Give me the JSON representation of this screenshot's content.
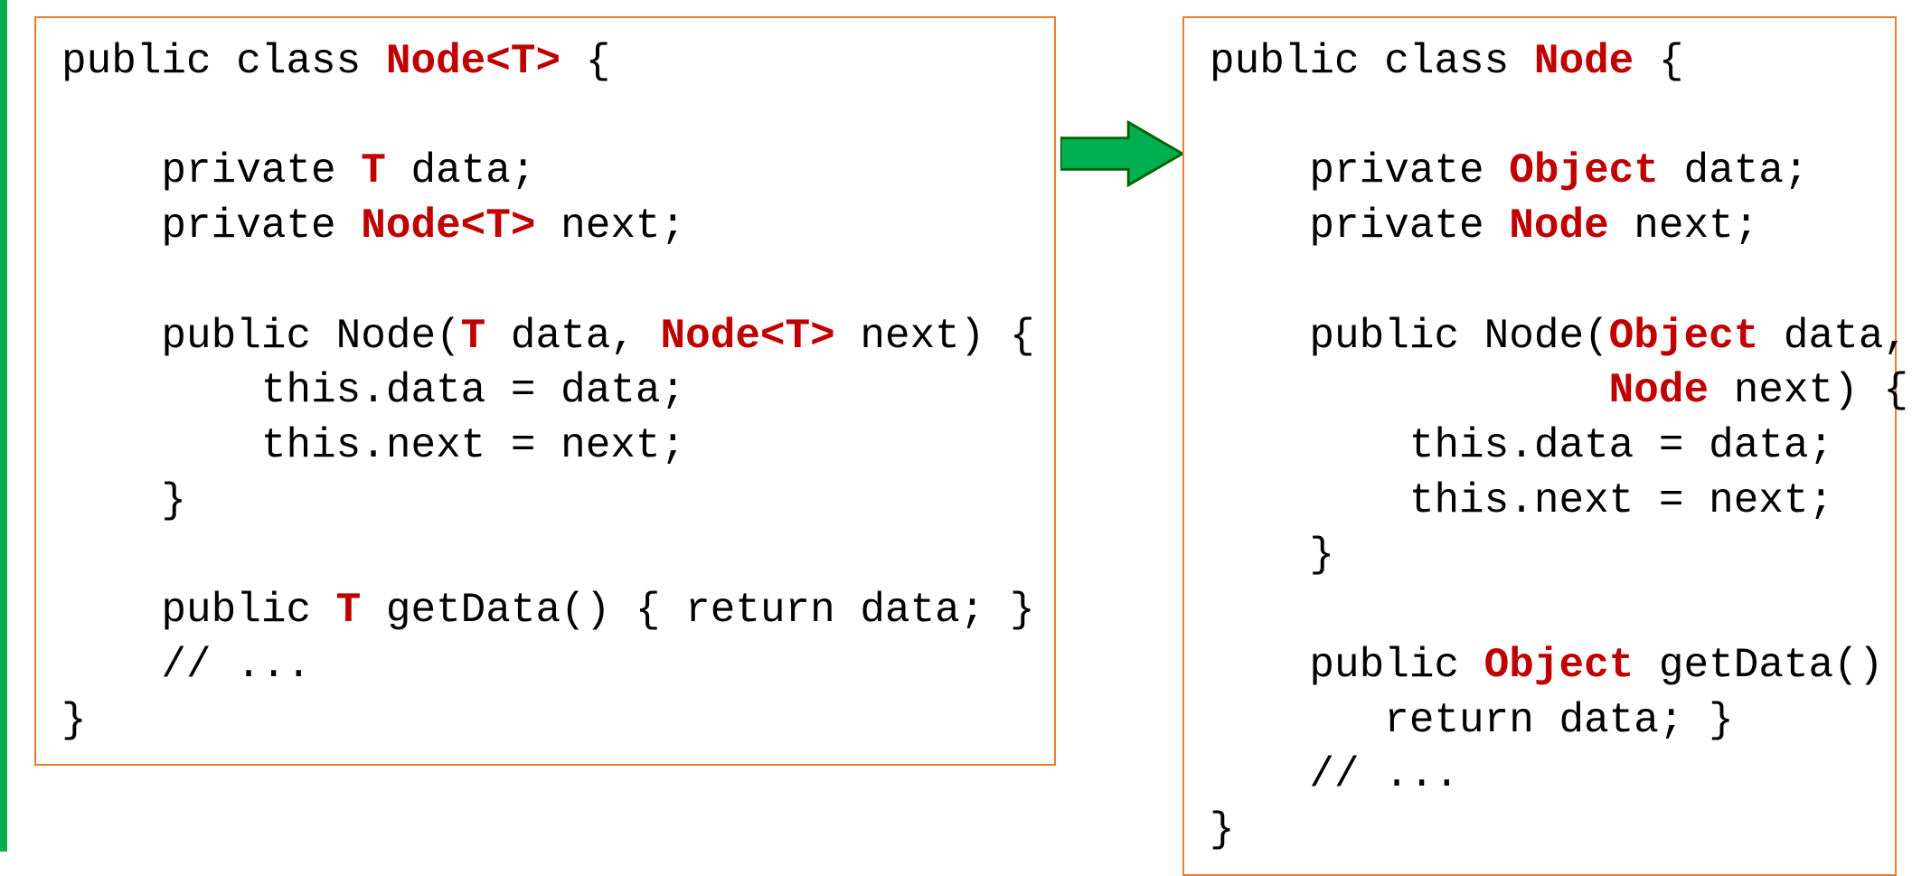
{
  "left": {
    "t0a": "public class ",
    "t0b": "Node<T>",
    "t0c": " {",
    "blank": "",
    "t1a": "    private ",
    "t1b": "T",
    "t1c": " data;",
    "t2a": "    private ",
    "t2b": "Node<T>",
    "t2c": " next;",
    "t3a": "    public Node(",
    "t3b": "T",
    "t3c": " data, ",
    "t3d": "Node<T>",
    "t3e": " next) {",
    "t4": "        this.data = data;",
    "t5": "        this.next = next;",
    "t6": "    }",
    "t7a": "    public ",
    "t7b": "T",
    "t7c": " getData() { return data; }",
    "t8": "    // ...",
    "t9": "}"
  },
  "right": {
    "t0a": "public class ",
    "t0b": "Node",
    "t0c": " {",
    "blank": "",
    "t1a": "    private ",
    "t1b": "Object",
    "t1c": " data;",
    "t2a": "    private ",
    "t2b": "Node",
    "t2c": " next;",
    "t3a": "    public Node(",
    "t3b": "Object",
    "t3c": " data,",
    "t4a": "                ",
    "t4b": "Node",
    "t4c": " next) {",
    "t5": "        this.data = data;",
    "t6": "        this.next = next;",
    "t7": "    }",
    "t8a": "    public ",
    "t8b": "Object",
    "t8c": " getData() {",
    "t9": "       return data; }",
    "t10": "    // ...",
    "t11": "}"
  }
}
